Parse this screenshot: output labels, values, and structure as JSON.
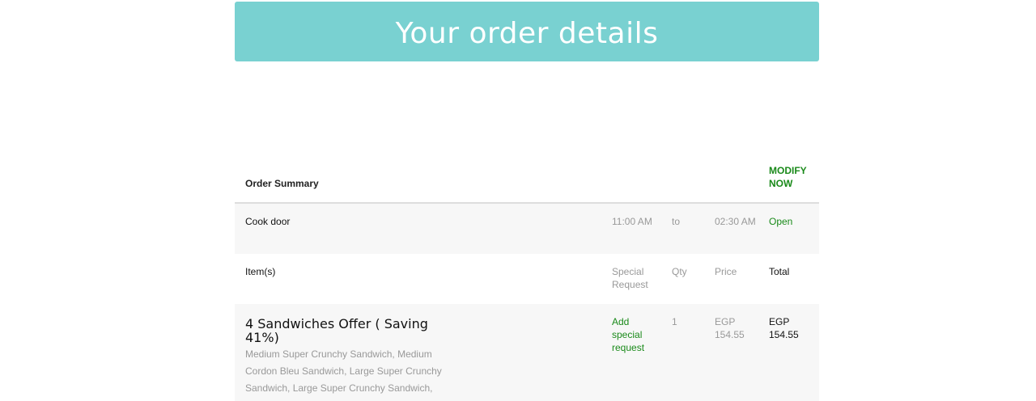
{
  "banner": {
    "title": "Your order details"
  },
  "summary": {
    "title": "Order Summary",
    "modify_label": "MODIFY NOW"
  },
  "store": {
    "name": "Cook door",
    "open_time": "11:00 AM",
    "separator": "to",
    "close_time": "02:30 AM",
    "status": "Open"
  },
  "columns": {
    "items": "Item(s)",
    "special_request": "Special Request",
    "qty": "Qty",
    "price": "Price",
    "total": "Total"
  },
  "item": {
    "name": "4 Sandwiches Offer ( Saving 41%)",
    "description": "Medium Super Crunchy Sandwich, Medium Cordon Bleu Sandwich, Large Super Crunchy Sandwich, Large Super Crunchy Sandwich,",
    "special_request_link": "Add special request",
    "qty": "1",
    "price": "EGP 154.55",
    "total": "EGP 154.55"
  },
  "colors": {
    "banner": "#79d1d1",
    "accent_green": "#1a8a1a"
  }
}
